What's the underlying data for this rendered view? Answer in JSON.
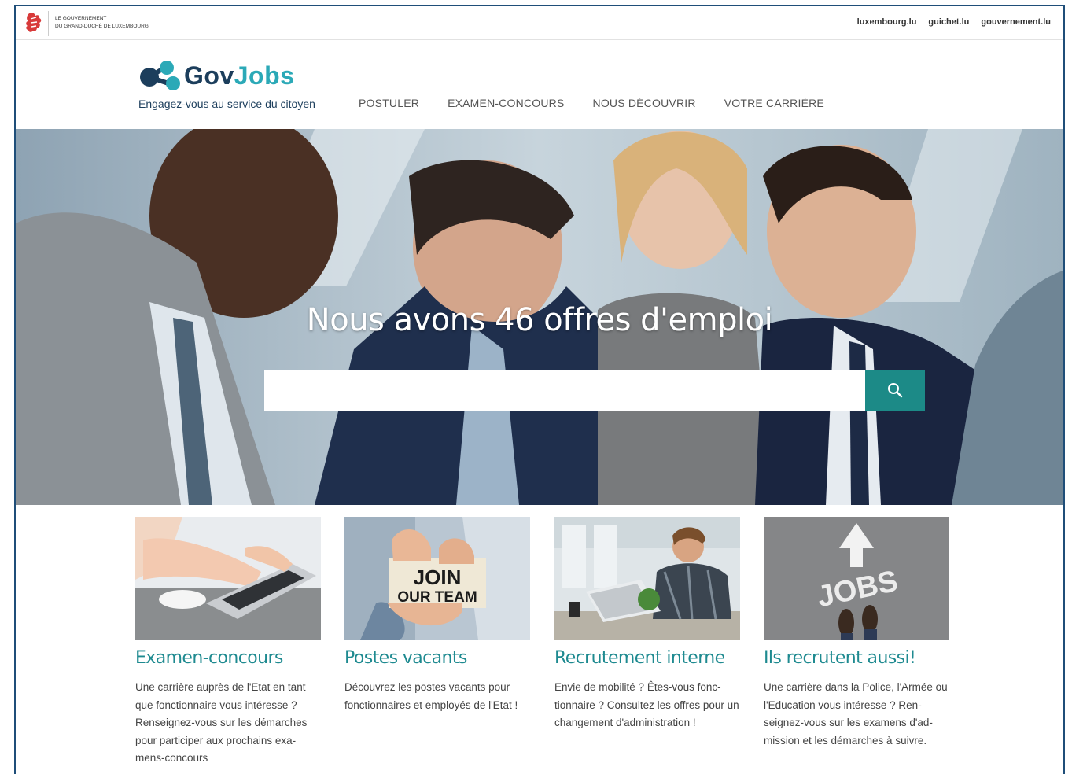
{
  "gov_bar": {
    "line1": "Le Gouvernement",
    "line2": "du Grand-Duché de Luxembourg",
    "links": [
      "luxembourg.lu",
      "guichet.lu",
      "gouvernement.lu"
    ]
  },
  "logo": {
    "part1": "Gov",
    "part2": "Jobs",
    "tagline": "Engagez-vous au service du citoyen"
  },
  "nav": [
    "POSTULER",
    "EXAMEN-CONCOURS",
    "NOUS DÉCOUVRIR",
    "VOTRE CARRIÈRE"
  ],
  "hero": {
    "title": "Nous avons 46 offres d'emploi",
    "search_placeholder": ""
  },
  "cards": [
    {
      "title": "Examen-concours",
      "text": "Une carrière auprès de l'Etat en tant que fonctionnaire vous intéresse ? Renseignez-vous sur les démarches pour participer aux prochains exa-mens-concours"
    },
    {
      "title": "Postes vacants",
      "text": "Découvrez les postes vacants pour fonctionnaires et employés de l'Etat !",
      "image_text_1": "JOIN",
      "image_text_2": "OUR TEAM"
    },
    {
      "title": "Recrutement interne",
      "text": "Envie de mobilité ? Êtes-vous fonc-tionnaire ? Consultez les offres pour un changement d'administration !"
    },
    {
      "title": "Ils recrutent aussi!",
      "text": "Une carrière dans la Police, l'Armée ou l'Education vous intéresse ? Ren-seignez-vous sur les examens d'ad-mission et les démarches à suivre.",
      "image_text_1": "JOBS"
    }
  ],
  "colors": {
    "accent": "#1e8a90",
    "search_button": "#1c8a87",
    "navy": "#1c3e5c"
  }
}
